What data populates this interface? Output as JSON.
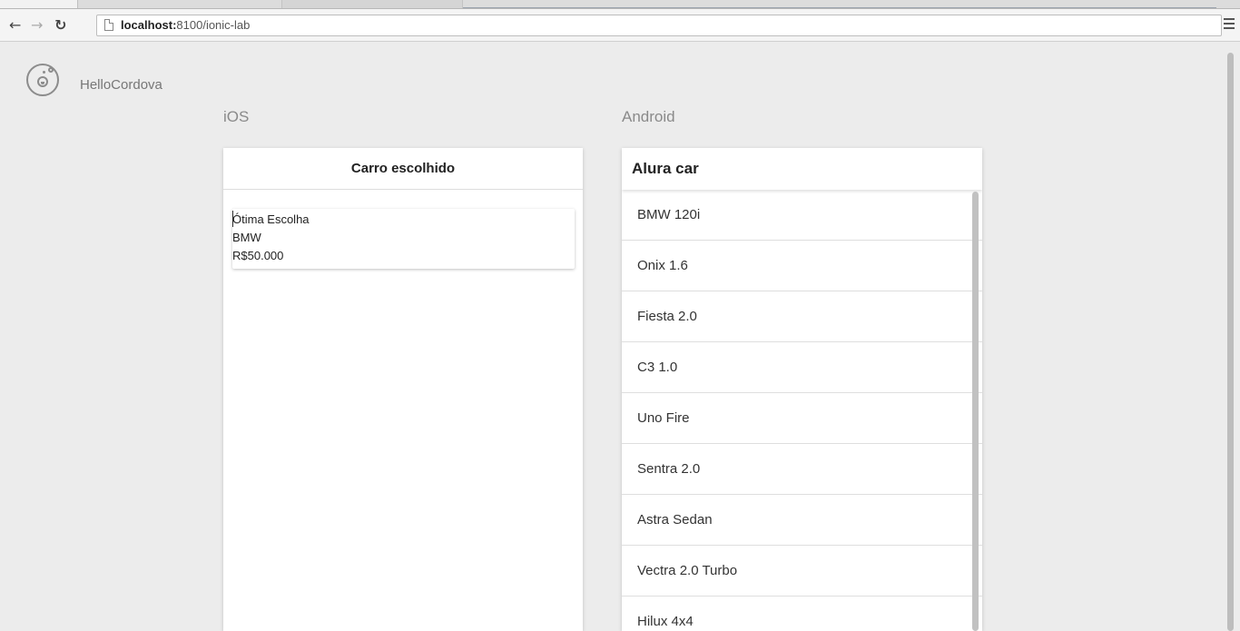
{
  "browser": {
    "url_host": "localhost:",
    "url_rest": "8100/ionic-lab",
    "back_icon": "arrow-left-icon",
    "forward_icon": "arrow-right-icon",
    "reload_icon": "reload-icon",
    "menu_icon": "hamburger-menu-icon"
  },
  "lab": {
    "app_name": "HelloCordova",
    "logo_icon": "ionic-lab-flask-icon",
    "ios_label": "iOS",
    "android_label": "Android"
  },
  "ios": {
    "title": "Carro escolhido",
    "card": {
      "line1": "Ótima Escolha",
      "line2": "BMW",
      "line3": "R$50.000"
    }
  },
  "android": {
    "title": "Alura car",
    "items": [
      "BMW 120i",
      "Onix 1.6",
      "Fiesta 2.0",
      "C3 1.0",
      "Uno Fire",
      "Sentra 2.0",
      "Astra Sedan",
      "Vectra 2.0 Turbo",
      "Hilux 4x4"
    ]
  },
  "colors": {
    "page_background": "#ececec",
    "card_background": "#ffffff",
    "label_gray": "#8a8a8a"
  }
}
